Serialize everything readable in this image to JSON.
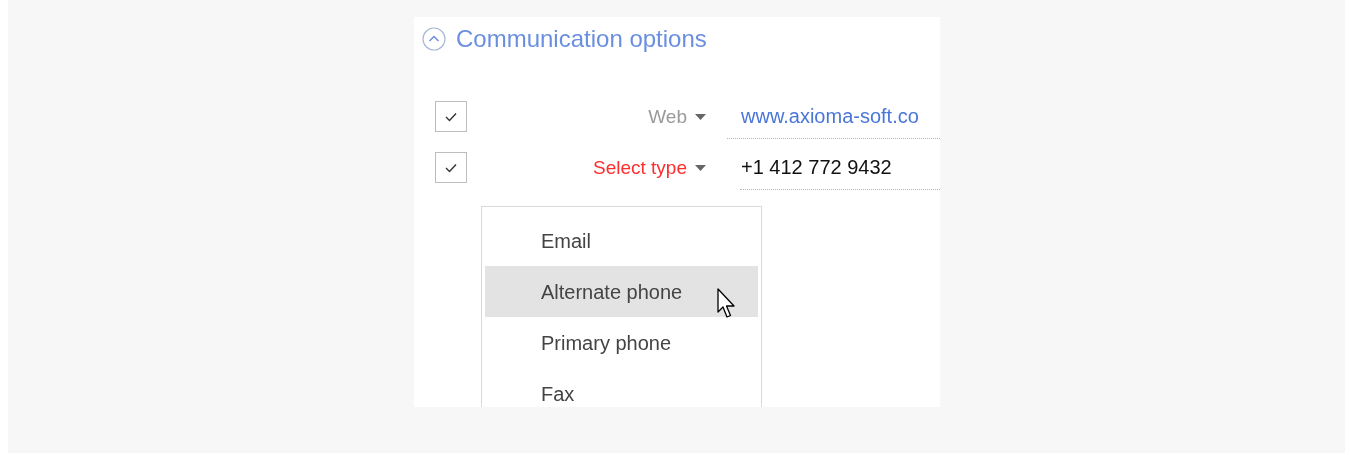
{
  "section": {
    "title": "Communication options",
    "expanded": true
  },
  "rows": [
    {
      "checked": true,
      "type": "Web",
      "invalid": false,
      "value": "www.axioma-soft.co",
      "kind": "link"
    },
    {
      "checked": true,
      "type": "Select type",
      "invalid": true,
      "value": "+1 412 772 9432",
      "kind": "text"
    }
  ],
  "dropdown": {
    "items": [
      {
        "label": "Email",
        "selected": false
      },
      {
        "label": "Alternate phone",
        "selected": true
      },
      {
        "label": "Primary phone",
        "selected": false
      },
      {
        "label": "Fax",
        "selected": false
      }
    ]
  }
}
